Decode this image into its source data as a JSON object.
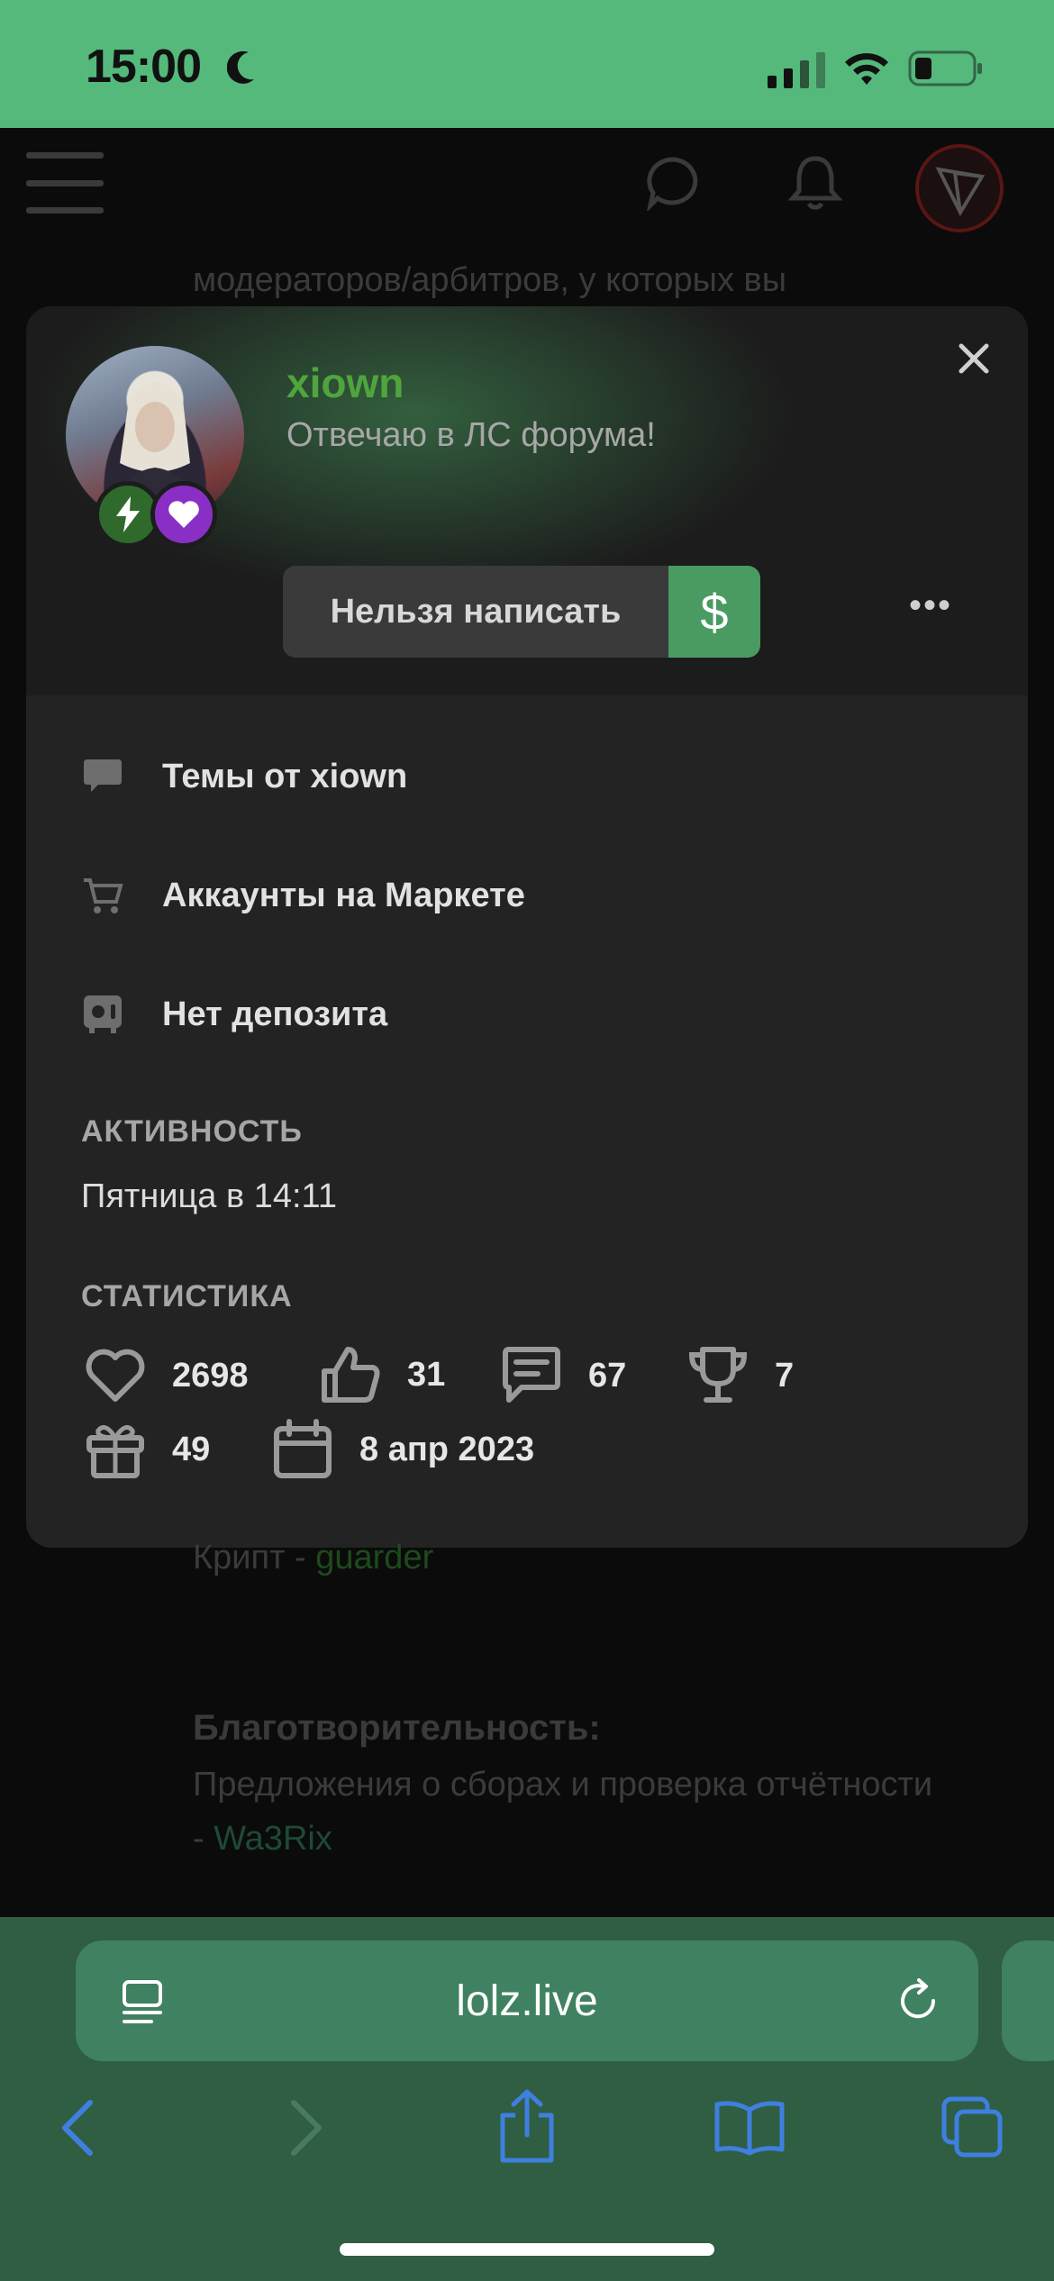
{
  "status_bar": {
    "time": "15:00"
  },
  "background": {
    "line1": "модераторов/арбитров, у которых вы",
    "cript_label": "Крипт - ",
    "cript_user": "guarder",
    "charity_title": "Благотворительность:",
    "charity_text": "Предложения о сборах и проверка отчётности",
    "charity_dash": "- ",
    "charity_user": "Wa3Rix"
  },
  "profile": {
    "username": "xiown",
    "status": "Отвечаю в ЛС форума!",
    "cant_write_label": "Нельзя написать",
    "dollar_label": "$",
    "more_label": "•••"
  },
  "menu": [
    {
      "label": "Темы от xiown",
      "icon": "chat-bubble-icon"
    },
    {
      "label": "Аккаунты на Маркете",
      "icon": "cart-icon"
    },
    {
      "label": "Нет депозита",
      "icon": "safe-icon"
    }
  ],
  "activity": {
    "title": "АКТИВНОСТЬ",
    "value": "Пятница в 14:11"
  },
  "stats": {
    "title": "СТАТИСТИКА",
    "likes": "2698",
    "thumbs": "31",
    "messages": "67",
    "trophies": "7",
    "gifts": "49",
    "registered": "8 апр 2023"
  },
  "browser": {
    "url": "lolz.live"
  },
  "colors": {
    "accent": "#4a9b62",
    "status_bar": "#55b97b",
    "safari": "#2f5e42",
    "username": "#4fa53d"
  }
}
